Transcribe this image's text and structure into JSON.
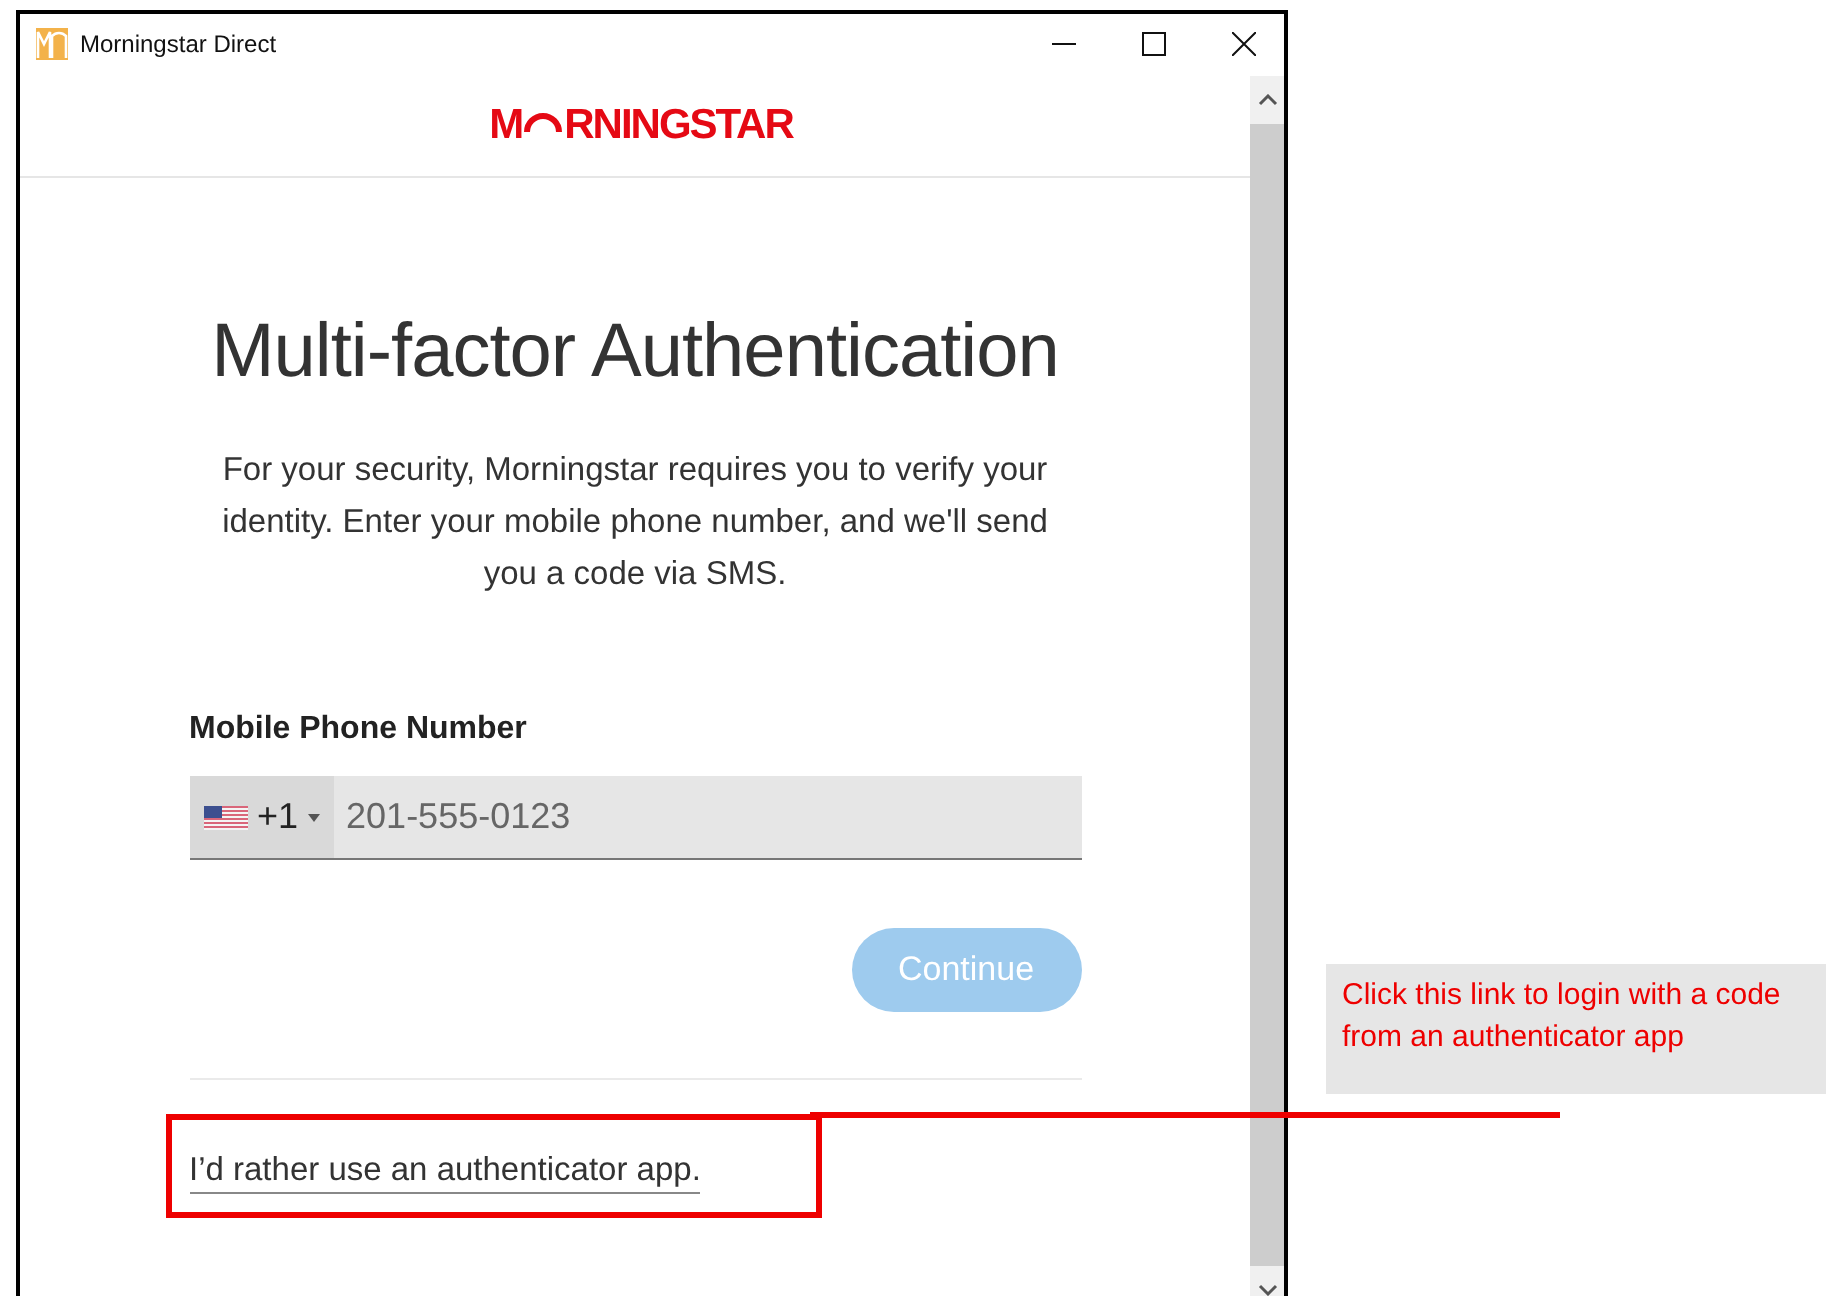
{
  "window": {
    "title": "Morningstar Direct"
  },
  "logo": {
    "before": "M",
    "after": "RNINGSTAR"
  },
  "heading": "Multi-factor Authentication",
  "intro": "For your security, Morningstar requires you to verify your identity. Enter your mobile phone number, and we'll send you a code via SMS.",
  "phone": {
    "label": "Mobile Phone Number",
    "country_code": "+1",
    "placeholder": "201-555-0123"
  },
  "continue_button": {
    "label": "Continue",
    "disabled": true
  },
  "alt_link": "I’d rather use an authenticator app.",
  "callout": {
    "text": "Click this link to login with a code from an authenticator app"
  }
}
